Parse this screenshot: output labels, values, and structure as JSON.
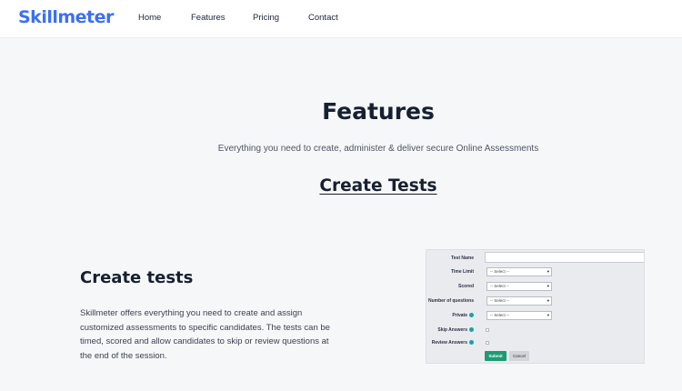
{
  "header": {
    "logo": "Skillmeter",
    "nav": [
      "Home",
      "Features",
      "Pricing",
      "Contact"
    ]
  },
  "hero": {
    "title": "Features",
    "subtitle": "Everything you need to create, administer & deliver secure Online Assessments",
    "section_link": "Create Tests"
  },
  "feature": {
    "title": "Create tests",
    "description": "Skillmeter offers everything you need to create and assign customized assessments to specific candidates. The tests can be timed, scored and allow candidates to skip or review questions at the end of the session."
  },
  "form": {
    "fields": [
      {
        "label": "Test Name",
        "type": "text",
        "value": "",
        "help": false
      },
      {
        "label": "Time Limit",
        "type": "select",
        "value": "-- Select --",
        "help": false
      },
      {
        "label": "Scored",
        "type": "select",
        "value": "-- Select --",
        "help": false
      },
      {
        "label": "Number of questions",
        "type": "select",
        "value": "-- Select --",
        "help": false
      },
      {
        "label": "Private",
        "type": "select",
        "value": "-- Select --",
        "help": true
      },
      {
        "label": "Skip Answers",
        "type": "checkbox",
        "value": "",
        "help": true
      },
      {
        "label": "Review Answers",
        "type": "checkbox",
        "value": "",
        "help": true
      }
    ],
    "submit_label": "Submit",
    "cancel_label": "Cancel",
    "select_arrow": "▾"
  },
  "colors": {
    "brand": "#3b6ff5",
    "submit": "#1e9b72",
    "help_icon": "#16a3a3"
  }
}
